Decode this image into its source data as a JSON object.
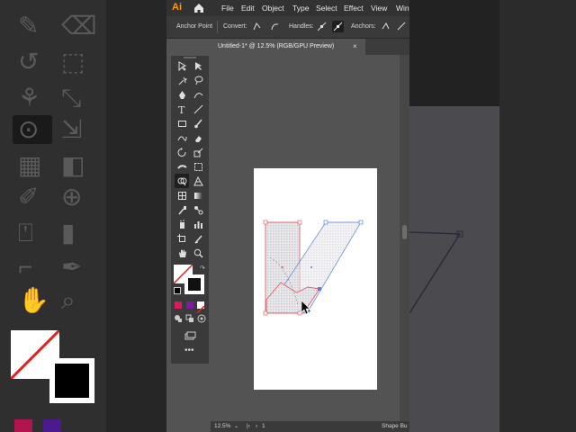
{
  "menubar": {
    "app_logo": "Ai",
    "items": [
      "File",
      "Edit",
      "Object",
      "Type",
      "Select",
      "Effect",
      "View",
      "Wind"
    ]
  },
  "control_bar": {
    "tool_name": "Anchor Point",
    "convert_label": "Convert:",
    "handles_label": "Handles:",
    "anchors_label": "Anchors:"
  },
  "document_tab": {
    "title": "Untitled-1* @ 12.5% (RGB/GPU Preview)",
    "close": "×"
  },
  "status_bar": {
    "zoom": "12.5%",
    "page": "1",
    "tool_hint": "Shape Bu"
  },
  "colors": {
    "gradient_start": "#e8177e",
    "gradient_end": "#5a2bd0",
    "fill_swatch": "#e2175f",
    "stroke_swatch": "#1a1a1a",
    "selection_red": "#e0606a",
    "selection_blue": "#5b7fd8"
  }
}
